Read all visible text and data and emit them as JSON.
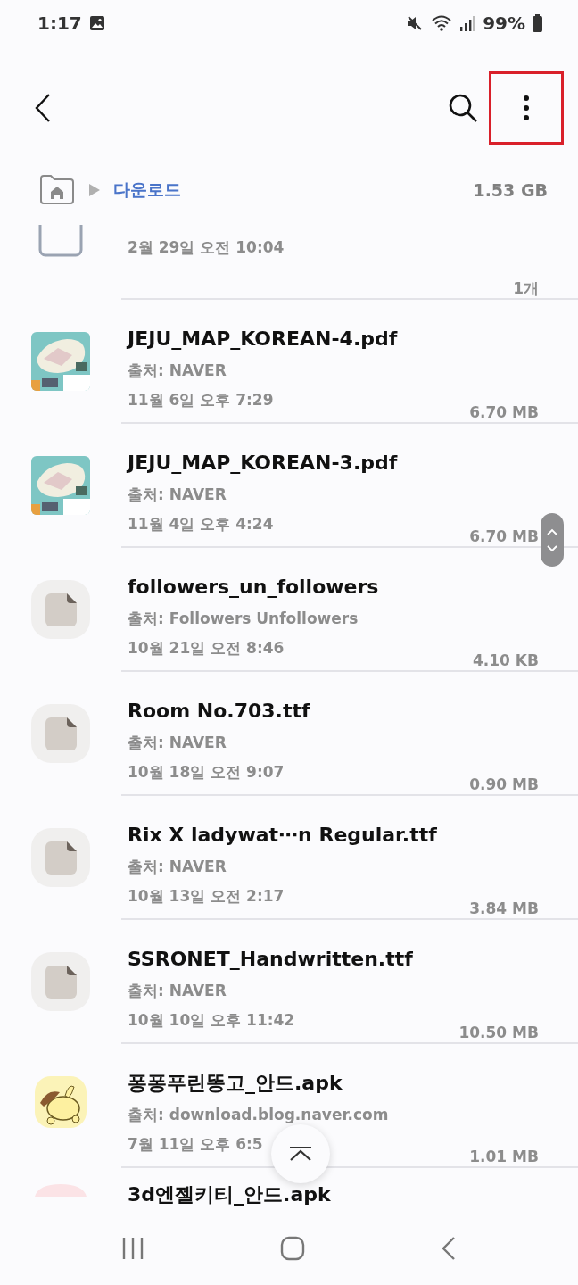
{
  "status_bar": {
    "time": "1:17",
    "battery": "99%"
  },
  "toolbar": {
    "more_highlighted": true
  },
  "path_bar": {
    "folder": "다운로드",
    "size": "1.53 GB"
  },
  "files": [
    {
      "kind": "folder",
      "date": "2월 29일 오전 10:04",
      "size": "1개"
    },
    {
      "kind": "map",
      "name": "JEJU_MAP_KOREAN-4.pdf",
      "source": "출처: NAVER",
      "date": "11월 6일 오후 7:29",
      "size": "6.70 MB"
    },
    {
      "kind": "map",
      "name": "JEJU_MAP_KOREAN-3.pdf",
      "source": "출처: NAVER",
      "date": "11월 4일 오후 4:24",
      "size": "6.70 MB"
    },
    {
      "kind": "document",
      "name": "followers_un_followers",
      "source": "출처: Followers Unfollowers",
      "date": "10월 21일 오전 8:46",
      "size": "4.10 KB"
    },
    {
      "kind": "document",
      "name": "Room No.703.ttf",
      "source": "출처: NAVER",
      "date": "10월 18일 오전 9:07",
      "size": "0.90 MB"
    },
    {
      "kind": "document",
      "name": "Rix X ladywat⋯n Regular.ttf",
      "source": "출처: NAVER",
      "date": "10월 13일 오전 2:17",
      "size": "3.84 MB"
    },
    {
      "kind": "document",
      "name": "SSRONET_Handwritten.ttf",
      "source": "출처: NAVER",
      "date": "10월 10일 오후 11:42",
      "size": "10.50 MB"
    },
    {
      "kind": "app",
      "name": "퐁퐁푸린똥고_안드.apk",
      "source": "출처: download.blog.naver.com",
      "date": "7월 11일 오후 6:5",
      "size": "1.01 MB"
    },
    {
      "kind": "app-pink",
      "name": "3d엔젤키티_안드.apk"
    }
  ]
}
